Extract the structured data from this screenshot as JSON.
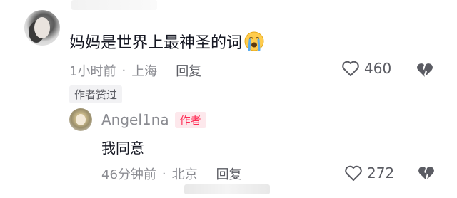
{
  "comment": {
    "text": "妈妈是世界上最神圣的词",
    "emoji": "crying-face-emoji",
    "time": "1小时前",
    "separator": "·",
    "location": "上海",
    "reply_label": "回复",
    "like_count": "460",
    "author_liked_badge": "作者赞过"
  },
  "reply": {
    "username": "Angel1na",
    "author_tag": "作者",
    "text": "我同意",
    "time": "46分钟前",
    "separator": "·",
    "location": "北京",
    "reply_label": "回复",
    "like_count": "272"
  },
  "colors": {
    "text_primary": "#161823",
    "text_secondary": "#8a8b91",
    "author_tag": "#fe2c55",
    "author_tag_bg": "#fde8ec"
  },
  "icons": {
    "like": "heart-outline-icon",
    "dislike": "broken-heart-icon"
  }
}
